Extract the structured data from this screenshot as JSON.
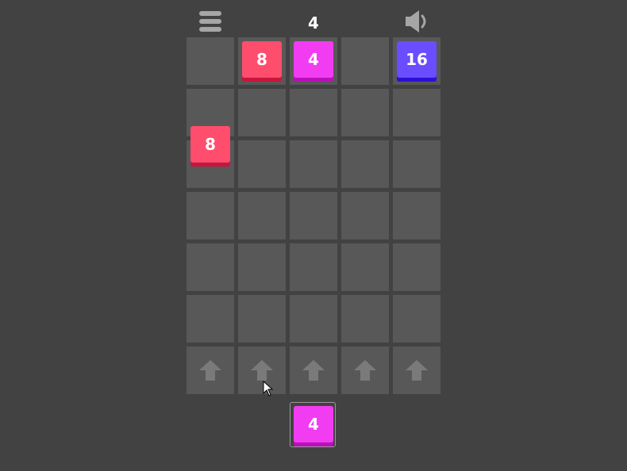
{
  "header": {
    "score": "4",
    "menu_icon": "hamburger-menu-icon",
    "sound_icon": "speaker-icon"
  },
  "board": {
    "columns": 5,
    "rows": 6,
    "tiles": [
      {
        "value": "8",
        "col": 1,
        "row": 0,
        "color": "#ff4d6d",
        "shadow": "#c9153c"
      },
      {
        "value": "4",
        "col": 2,
        "row": 0,
        "color": "#f23cf2",
        "shadow": "#b811b8"
      },
      {
        "value": "16",
        "col": 4,
        "row": 0,
        "color": "#6a4dff",
        "shadow": "#2a10d6"
      },
      {
        "value": "8",
        "col": 0,
        "row": 1.65,
        "color": "#ff4d6d",
        "shadow": "#c9153c"
      }
    ],
    "launch_icon": "up-arrow-icon"
  },
  "next_tile": {
    "value": "4",
    "color": "#f23cf2",
    "shadow": "#b811b8"
  },
  "colors": {
    "background": "#424242",
    "cell": "#585858",
    "icon": "#a6a6a6",
    "arrow": "#7a7a7a"
  }
}
